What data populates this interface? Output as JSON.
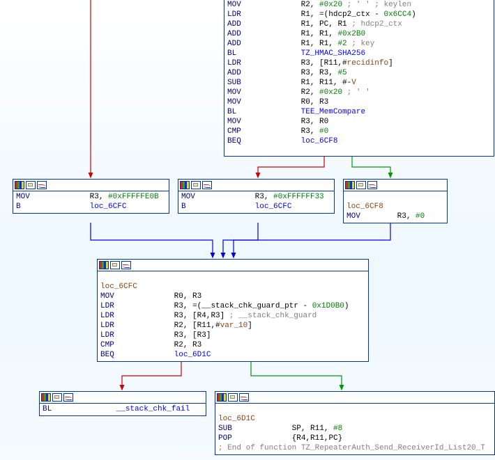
{
  "chart_data": {
    "type": "flowgraph",
    "nodes": [
      "top",
      "b1",
      "b2",
      "b3",
      "mid",
      "fail",
      "end"
    ],
    "edges": [
      {
        "from": "offtop",
        "to": "b1",
        "color": "red"
      },
      {
        "from": "top",
        "to": "b2",
        "color": "red"
      },
      {
        "from": "top",
        "to": "b3",
        "color": "green"
      },
      {
        "from": "b1",
        "to": "mid",
        "color": "blue"
      },
      {
        "from": "b2",
        "to": "mid",
        "color": "blue"
      },
      {
        "from": "b3",
        "to": "mid",
        "color": "blue"
      },
      {
        "from": "mid",
        "to": "fail",
        "color": "red"
      },
      {
        "from": "mid",
        "to": "end",
        "color": "green"
      }
    ]
  },
  "top": {
    "l1a": "MOV",
    "l1b": "R2, ",
    "l1c": "#0x20",
    "l1d": " ; ' ' ; keylen",
    "l2a": "LDR",
    "l2b": "R1, =(hdcp2_ctx - ",
    "l2c": "0x6CC4",
    "l2d": ")",
    "l3a": "ADD",
    "l3b": "R1, PC, R1 ",
    "l3c": "; hdcp2_ctx",
    "l4a": "ADD",
    "l4b": "R1, R1, ",
    "l4c": "#0x2B0",
    "l5a": "ADD",
    "l5b": "R1, R1, ",
    "l5c": "#2",
    "l5d": " ; key",
    "l6a": "BL",
    "l6b": "TZ_HMAC_SHA256",
    "l7a": "LDR",
    "l7b": "R3, [R11,#",
    "l7c": "recidinfo",
    "l7d": "]",
    "l8a": "ADD",
    "l8b": "R3, R3, ",
    "l8c": "#5",
    "l9a": "SUB",
    "l9b": "R1, R11, #-",
    "l9c": "V",
    "l10a": "MOV",
    "l10b": "R2, ",
    "l10c": "#0x20",
    "l10d": " ; ' '",
    "l11a": "MOV",
    "l11b": "R0, R3",
    "l12a": "BL",
    "l12b": "TEE_MemCompare",
    "l13a": "MOV",
    "l13b": "R3, R0",
    "l14a": "CMP",
    "l14b": "R3, ",
    "l14c": "#0",
    "l15a": "BEQ",
    "l15b": "loc_6CF8"
  },
  "b1": {
    "l1a": "MOV",
    "l1b": "R3, ",
    "l1c": "#0xFFFFFE0B",
    "l2a": "B",
    "l2b": "loc_6CFC"
  },
  "b2": {
    "l1a": "MOV",
    "l1b": "R3, ",
    "l1c": "#0xFFFFFF33",
    "l2a": "B",
    "l2b": "loc_6CFC"
  },
  "b3": {
    "label": "loc_6CF8",
    "l1a": "MOV",
    "l1b": "R3, ",
    "l1c": "#0"
  },
  "mid": {
    "label": "loc_6CFC",
    "l1a": "MOV",
    "l1b": "R0, R3",
    "l2a": "LDR",
    "l2b": "R3, =(__stack_chk_guard_ptr - ",
    "l2c": "0x1D0B0",
    "l2d": ")",
    "l3a": "LDR",
    "l3b": "R3, [R4,R3] ",
    "l3c": "; __stack_chk_guard",
    "l4a": "LDR",
    "l4b": "R2, [R11,#",
    "l4c": "var_10",
    "l4d": "]",
    "l5a": "LDR",
    "l5b": "R3, [R3]",
    "l6a": "CMP",
    "l6b": "R2, R3",
    "l7a": "BEQ",
    "l7b": "loc_6D1C"
  },
  "fail": {
    "l1a": "BL",
    "l1b": "__stack_chk_fail"
  },
  "end": {
    "label": "loc_6D1C",
    "l1a": "SUB",
    "l1b": "SP, R11, ",
    "l1c": "#8",
    "l2a": "POP",
    "l2b": "{R4,R11,PC}",
    "cmt": "; End of function TZ_RepeaterAuth_Send_ReceiverId_List20_T"
  }
}
